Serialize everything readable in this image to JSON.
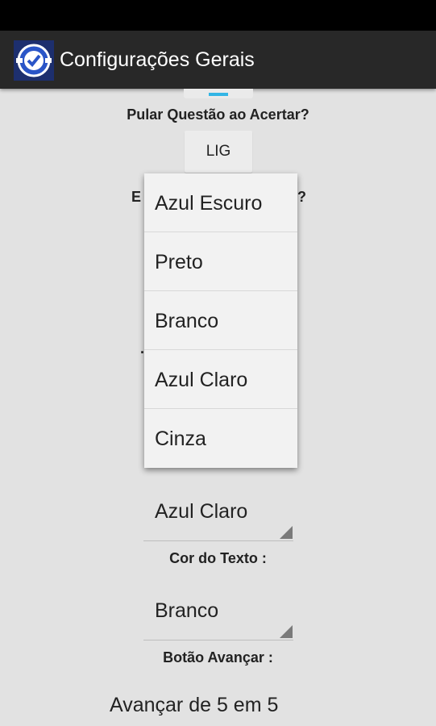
{
  "app": {
    "title": "Configurações Gerais"
  },
  "settings": {
    "skip_question_label": "Pular Questão ao Acertar?",
    "skip_question_toggle": "LIG",
    "partial_label_left": "E",
    "partial_label_right": "?",
    "partial_dot": ".",
    "background_value": "Azul Claro",
    "text_color_label": "Cor do Texto :",
    "text_color_value": "Branco",
    "advance_label": "Botão Avançar :",
    "advance_value": "Avançar de 5 em 5"
  },
  "dropdown": {
    "options": [
      "Azul Escuro",
      "Preto",
      "Branco",
      "Azul Claro",
      "Cinza"
    ]
  },
  "colors": {
    "action_bar": "#282828",
    "background": "#e2e2e2",
    "accent": "#33b5e5"
  }
}
